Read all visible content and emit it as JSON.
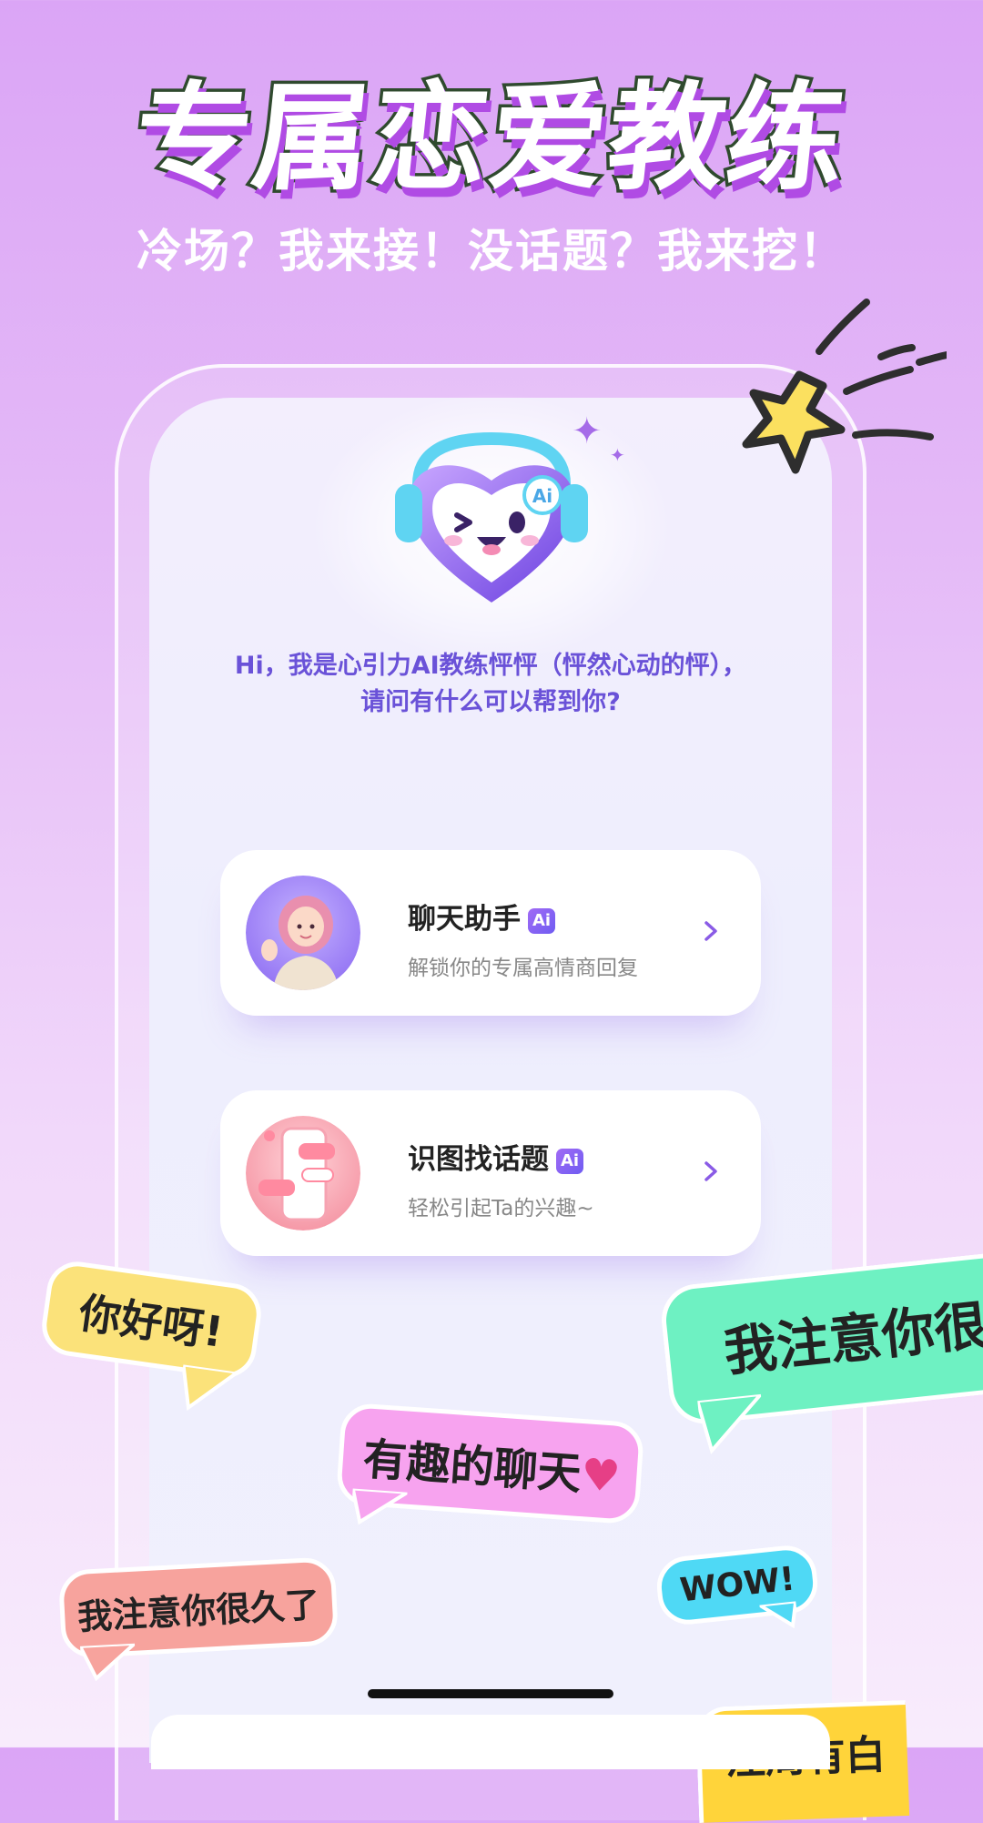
{
  "header": {
    "title": "专属恋爱教练",
    "subtitle": "冷场？我来接！没话题？我来挖！"
  },
  "assistant": {
    "greeting_line1": "Hi，我是心引力AI教练怦怦（怦然心动的怦），",
    "greeting_line2": "请问有什么可以帮到你?",
    "mascot_badge": "Ai"
  },
  "cards": [
    {
      "title": "聊天助手",
      "badge": "Ai",
      "description": "解锁你的专属高情商回复",
      "icon": "avatar-girl-waving"
    },
    {
      "title": "识图找话题",
      "badge": "Ai",
      "description": "轻松引起Ta的兴趣~",
      "icon": "phone-chat-bubbles"
    }
  ],
  "bubbles": {
    "hello": "你好呀!",
    "noticed_cut": "我注意你很",
    "fun_chat": "有趣的聊天",
    "noticed_long": "我注意你很久了",
    "wow": "WOW!",
    "bottom_right": "注周有白"
  },
  "colors": {
    "accent": "#6a52d8",
    "bubble_yellow": "#fbe27a",
    "bubble_green": "#6ef1c2",
    "bubble_pink": "#f7a3ef",
    "bubble_salmon": "#f7a39d",
    "bubble_cyan": "#4fd9f5",
    "bubble_gold": "#ffd43a"
  }
}
